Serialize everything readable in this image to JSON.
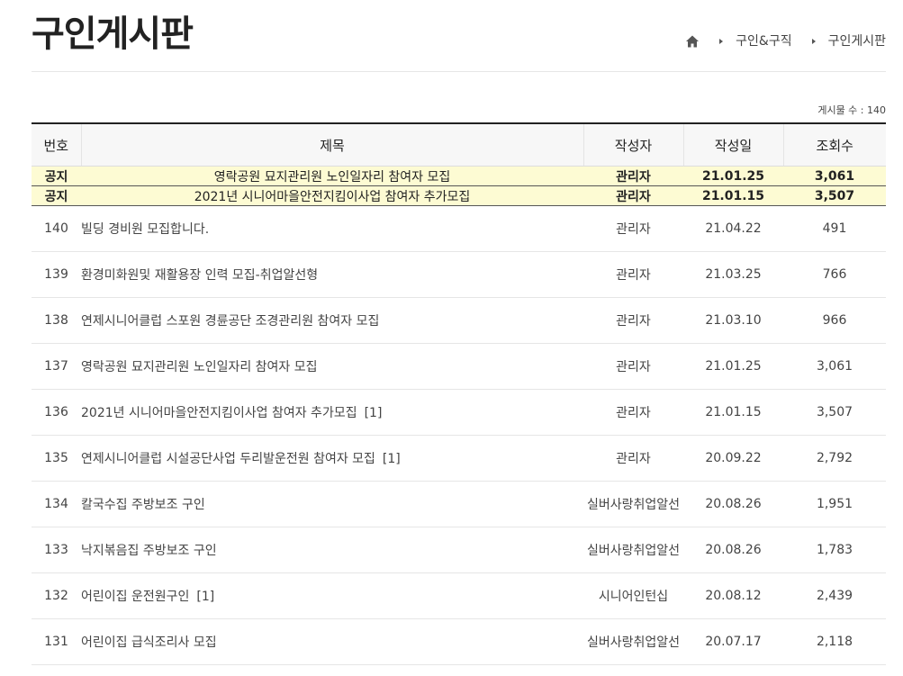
{
  "header": {
    "title": "구인게시판",
    "breadcrumb": {
      "home_icon": "home-icon",
      "items": [
        "구인&구직",
        "구인게시판"
      ]
    }
  },
  "board": {
    "post_count": "게시물 수 : 140",
    "columns": {
      "num": "번호",
      "title": "제목",
      "author": "작성자",
      "date": "작성일",
      "views": "조회수"
    },
    "notices": [
      {
        "label": "공지",
        "title": "영락공원 묘지관리원 노인일자리 참여자 모집",
        "author": "관리자",
        "date": "21.01.25",
        "views": "3,061"
      },
      {
        "label": "공지",
        "title": "2021년 시니어마을안전지킴이사업 참여자 추가모집",
        "author": "관리자",
        "date": "21.01.15",
        "views": "3,507"
      }
    ],
    "posts": [
      {
        "num": "140",
        "title": "빌딩 경비원 모집합니다.",
        "comments": "",
        "author": "관리자",
        "date": "21.04.22",
        "views": "491"
      },
      {
        "num": "139",
        "title": "환경미화원및 재활용장 인력 모집-취업알선형",
        "comments": "",
        "author": "관리자",
        "date": "21.03.25",
        "views": "766"
      },
      {
        "num": "138",
        "title": "연제시니어클럽 스포원 경륜공단 조경관리원 참여자 모집",
        "comments": "",
        "author": "관리자",
        "date": "21.03.10",
        "views": "966"
      },
      {
        "num": "137",
        "title": "영락공원 묘지관리원 노인일자리 참여자 모집",
        "comments": "",
        "author": "관리자",
        "date": "21.01.25",
        "views": "3,061"
      },
      {
        "num": "136",
        "title": "2021년 시니어마을안전지킴이사업 참여자 추가모집",
        "comments": "[1]",
        "author": "관리자",
        "date": "21.01.15",
        "views": "3,507"
      },
      {
        "num": "135",
        "title": "연제시니어클럽 시설공단사업 두리발운전원 참여자 모집",
        "comments": "[1]",
        "author": "관리자",
        "date": "20.09.22",
        "views": "2,792"
      },
      {
        "num": "134",
        "title": "칼국수집 주방보조 구인",
        "comments": "",
        "author": "실버사랑취업알선",
        "date": "20.08.26",
        "views": "1,951"
      },
      {
        "num": "133",
        "title": "낙지볶음집 주방보조 구인",
        "comments": "",
        "author": "실버사랑취업알선",
        "date": "20.08.26",
        "views": "1,783"
      },
      {
        "num": "132",
        "title": "어린이집 운전원구인",
        "comments": "[1]",
        "author": "시니어인턴십",
        "date": "20.08.12",
        "views": "2,439"
      },
      {
        "num": "131",
        "title": "어린이집 급식조리사 모집",
        "comments": "",
        "author": "실버사랑취업알선",
        "date": "20.07.17",
        "views": "2,118"
      }
    ]
  }
}
